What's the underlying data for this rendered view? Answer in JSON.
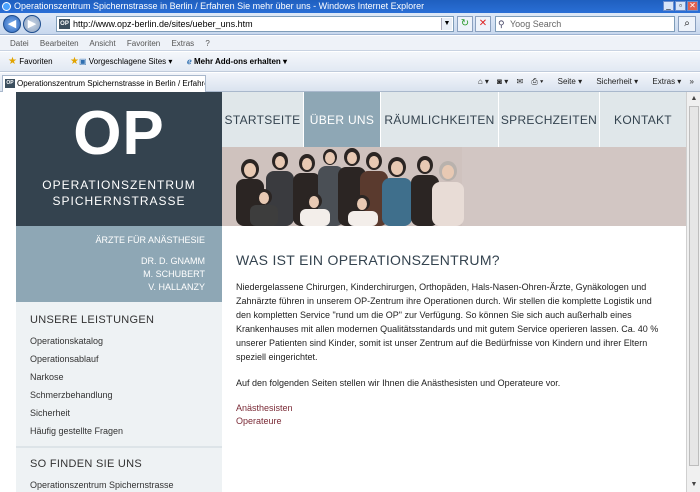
{
  "window": {
    "title": "Operationszentrum Spichernstrasse in Berlin / Erfahren Sie mehr über uns - Windows Internet Explorer"
  },
  "addressbar": {
    "url": "http://www.opz-berlin.de/sites/ueber_uns.htm",
    "search_placeholder": "Yoog Search"
  },
  "menu": [
    "Datei",
    "Bearbeiten",
    "Ansicht",
    "Favoriten",
    "Extras",
    "?"
  ],
  "favbar": {
    "favorites": "Favoriten",
    "suggested": "Vorgeschlagene Sites",
    "addons": "Mehr Add-ons erhalten"
  },
  "tab": {
    "title": "Operationszentrum Spichernstrasse in Berlin / Erfahre..."
  },
  "tools": {
    "page": "Seite",
    "security": "Sicherheit",
    "extras": "Extras"
  },
  "logo": {
    "mark": "OP",
    "line1": "OPERATIONSZENTRUM",
    "line2": "SPICHERNSTRASSE"
  },
  "anaesthesia": {
    "heading": "ÄRZTE FÜR ANÄSTHESIE",
    "doctors": [
      "DR. D. GNAMM",
      "M. SCHUBERT",
      "V. HALLANZY"
    ]
  },
  "services": {
    "heading": "UNSERE LEISTUNGEN",
    "items": [
      "Operationskatalog",
      "Operationsablauf",
      "Narkose",
      "Schmerzbehandlung",
      "Sicherheit",
      "Häufig gestellte Fragen"
    ]
  },
  "find": {
    "heading": "SO FINDEN SIE UNS",
    "items": [
      "Operationszentrum Spichernstrasse"
    ]
  },
  "nav": [
    "STARTSEITE",
    "ÜBER UNS",
    "RÄUMLICHKEITEN",
    "SPRECHZEITEN",
    "KONTAKT"
  ],
  "main": {
    "heading": "WAS IST EIN OPERATIONSZENTRUM?",
    "para1": "Niedergelassene Chirurgen, Kinderchirurgen, Orthopäden, Hals-Nasen-Ohren-Ärzte, Gynäkologen und Zahnärzte führen in unserem OP-Zentrum ihre Operationen durch. Wir stellen die komplette Logistik und den kompletten Service \"rund um die OP\" zur Verfügung. So können Sie sich auch außerhalb eines Krankenhauses mit allen modernen Qualitätsstandards und mit gutem Service operieren lassen. Ca. 40 % unserer Patienten sind Kinder, somit ist unser Zentrum auf die Bedürfnisse von Kindern und ihrer Eltern speziell eingerichtet.",
    "para2": "Auf den folgenden Seiten stellen wir Ihnen die Anästhesisten und Operateure vor.",
    "links": [
      "Anästhesisten",
      "Operateure"
    ]
  },
  "colors": {
    "dark": "#34434f",
    "accent": "#8ea7b5",
    "link": "#7a2a36",
    "navbg": "#e0e7ea"
  }
}
